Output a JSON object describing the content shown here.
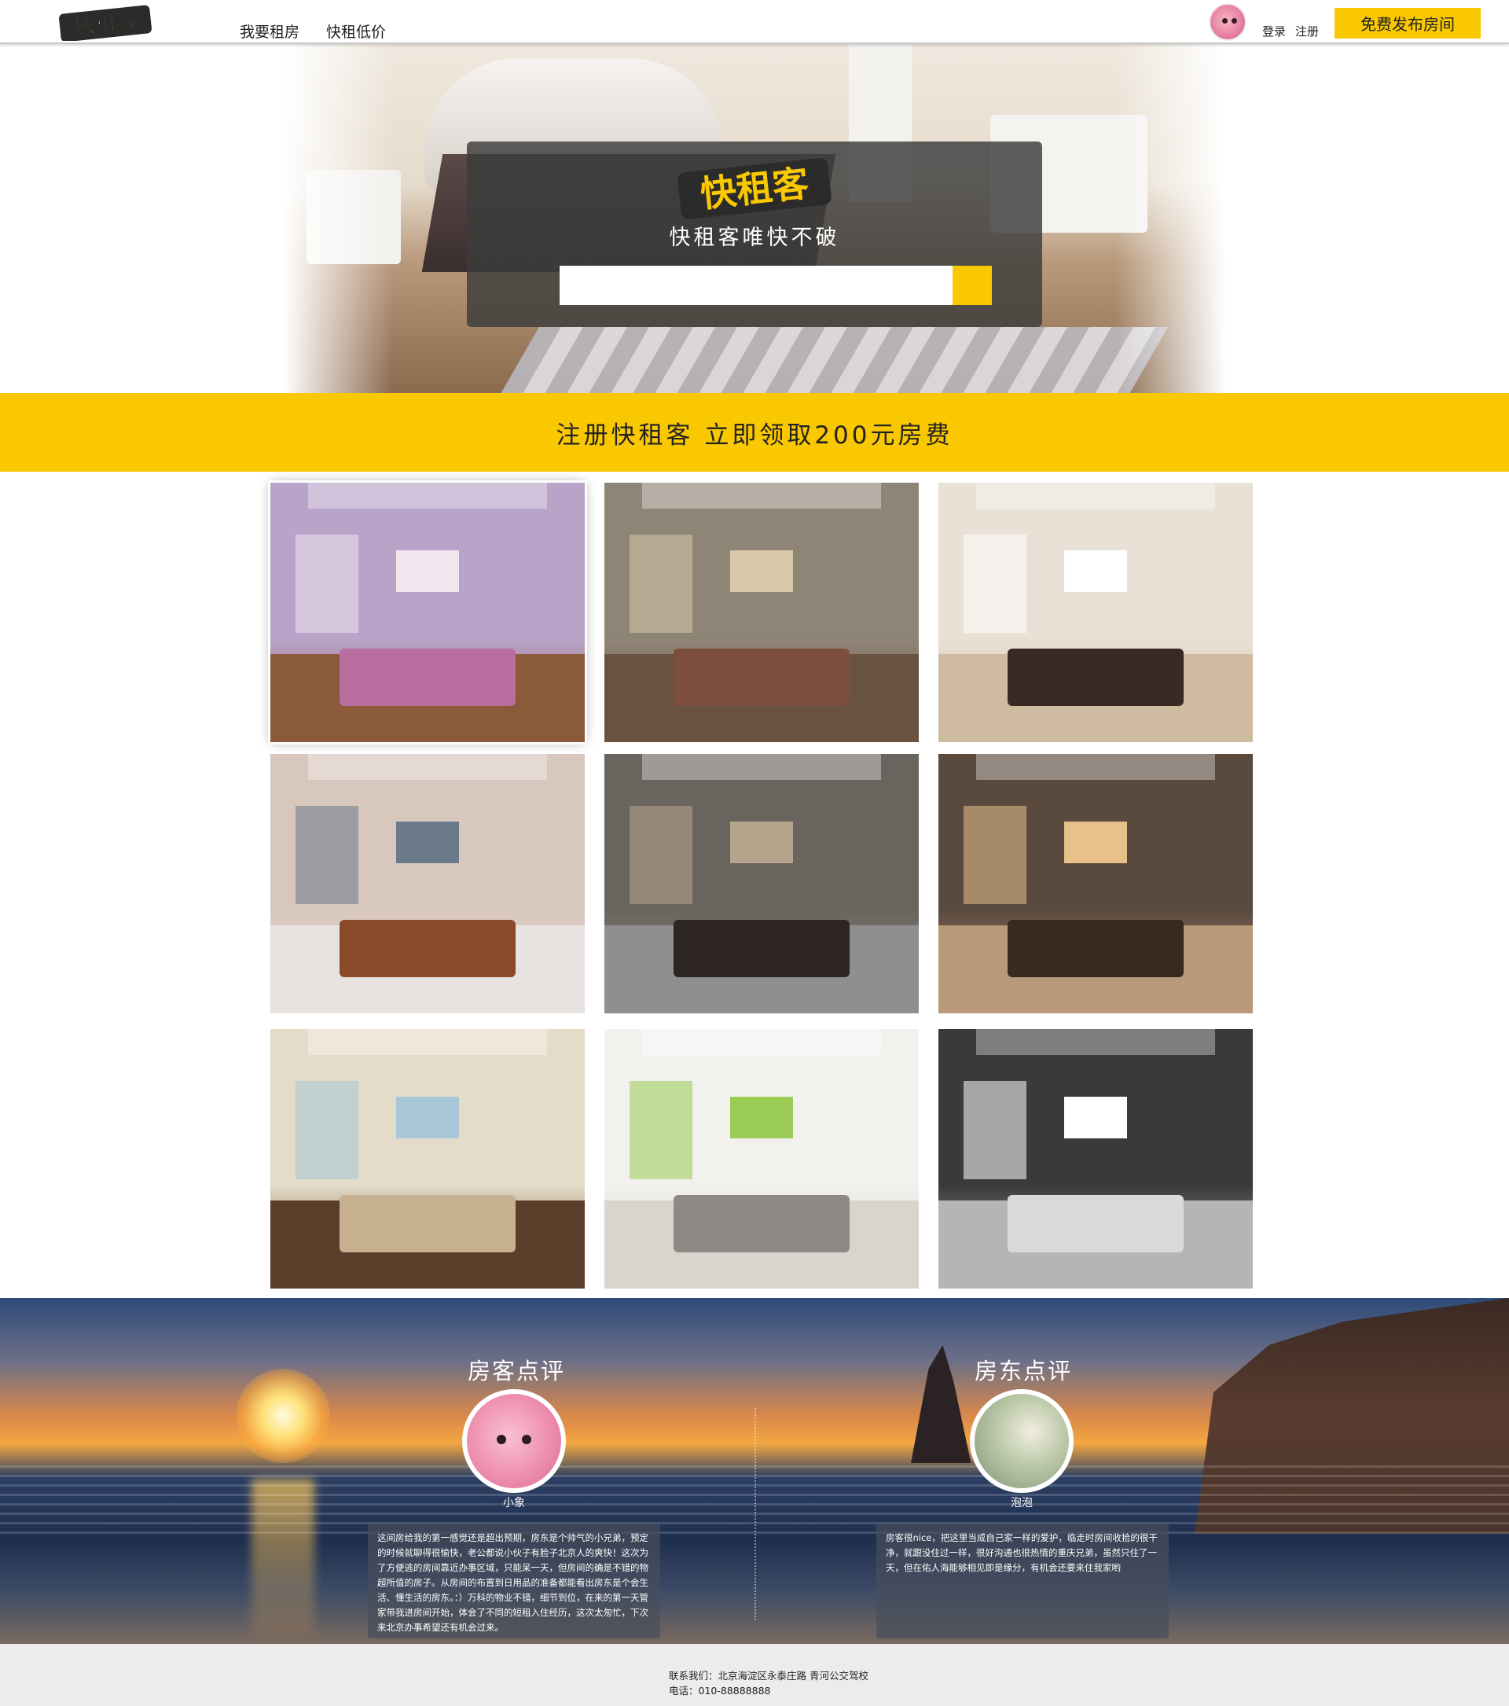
{
  "header": {
    "logo_text": "快租客",
    "nav": [
      "我要租房",
      "快租低价"
    ],
    "login_label": "登录",
    "register_label": "注册",
    "publish_label": "免费发布房间"
  },
  "hero": {
    "logo_text": "快租客",
    "slogan": "快租客唯快不破",
    "search_value": ""
  },
  "banner": {
    "text": "注册快租客 立即领取200元房费"
  },
  "gallery": {
    "tiles": [
      {
        "name": "pink-bedroom-photo",
        "wall": "#b9a3c9",
        "floor": "#8a5a3a",
        "furn": "#b86ea0",
        "accent": "#f1e6ee",
        "selected": true
      },
      {
        "name": "european-living-room-photo",
        "wall": "#8f8577",
        "floor": "#6a5240",
        "furn": "#7b4e3e",
        "accent": "#d8c7a8",
        "selected": false
      },
      {
        "name": "modern-bedroom-photo",
        "wall": "#e9e1d5",
        "floor": "#cfbba0",
        "furn": "#3b2a24",
        "accent": "#ffffff",
        "selected": false
      },
      {
        "name": "chinese-living-room-photo",
        "wall": "#d8c7bc",
        "floor": "#e8e2e0",
        "furn": "#8a4a2a",
        "accent": "#6a7a8a",
        "selected": false
      },
      {
        "name": "dark-chinese-dining-photo",
        "wall": "#6a645e",
        "floor": "#8f8f8f",
        "furn": "#2e2622",
        "accent": "#b5a58c",
        "selected": false
      },
      {
        "name": "luxury-hallway-photo",
        "wall": "#5a4a3e",
        "floor": "#b89a7a",
        "furn": "#3a2a1e",
        "accent": "#e8c08a",
        "selected": false
      },
      {
        "name": "sunny-living-room-photo",
        "wall": "#e4dcc8",
        "floor": "#5a3e2a",
        "furn": "#c7b08f",
        "accent": "#a8c7d8",
        "selected": false
      },
      {
        "name": "white-living-room-photo",
        "wall": "#f2f1ee",
        "floor": "#d9d4cc",
        "furn": "#8d8a86",
        "accent": "#9acc55",
        "selected": false
      },
      {
        "name": "black-white-living-room-photo",
        "wall": "#3a3a3a",
        "floor": "#b5b5b5",
        "furn": "#d9d9d9",
        "accent": "#ffffff",
        "selected": false
      }
    ]
  },
  "reviews": {
    "guest": {
      "title": "房客点评",
      "name": "小象",
      "text": "这间房给我的第一感觉还是超出预期，房东是个帅气的小兄弟，预定的时候就聊得很愉快，老公都说小伙子有脸子北京人的爽快！这次为了方便逃的房间靠近办事区域，只能呆一天，但房间的确是不错的物超所值的房子。从房间的布置到日用品的准备都能看出房东是个会生活、懂生活的房东。：）万科的物业不错，细节到位，在来的第一天管家带我进房间开始，体会了不同的短租入住经历，这次太匆忙，下次来北京办事希望还有机会过来。"
    },
    "host": {
      "title": "房东点评",
      "name": "泡泡",
      "text": "房客很nice，把这里当成自己家一样的爱护，临走时房间收拾的很干净，就跟没住过一样，很好沟通也很热情的重庆兄弟，虽然只住了一天，但在佑人海能够相见即是缘分，有机会还要来住我家哟"
    }
  },
  "footer": {
    "contact": "联系我们：北京海淀区永泰庄路 青河公交驾校",
    "phone": "电话：010-88888888"
  },
  "colors": {
    "brand_yellow": "#fac800",
    "footer_bg": "#ececec"
  }
}
